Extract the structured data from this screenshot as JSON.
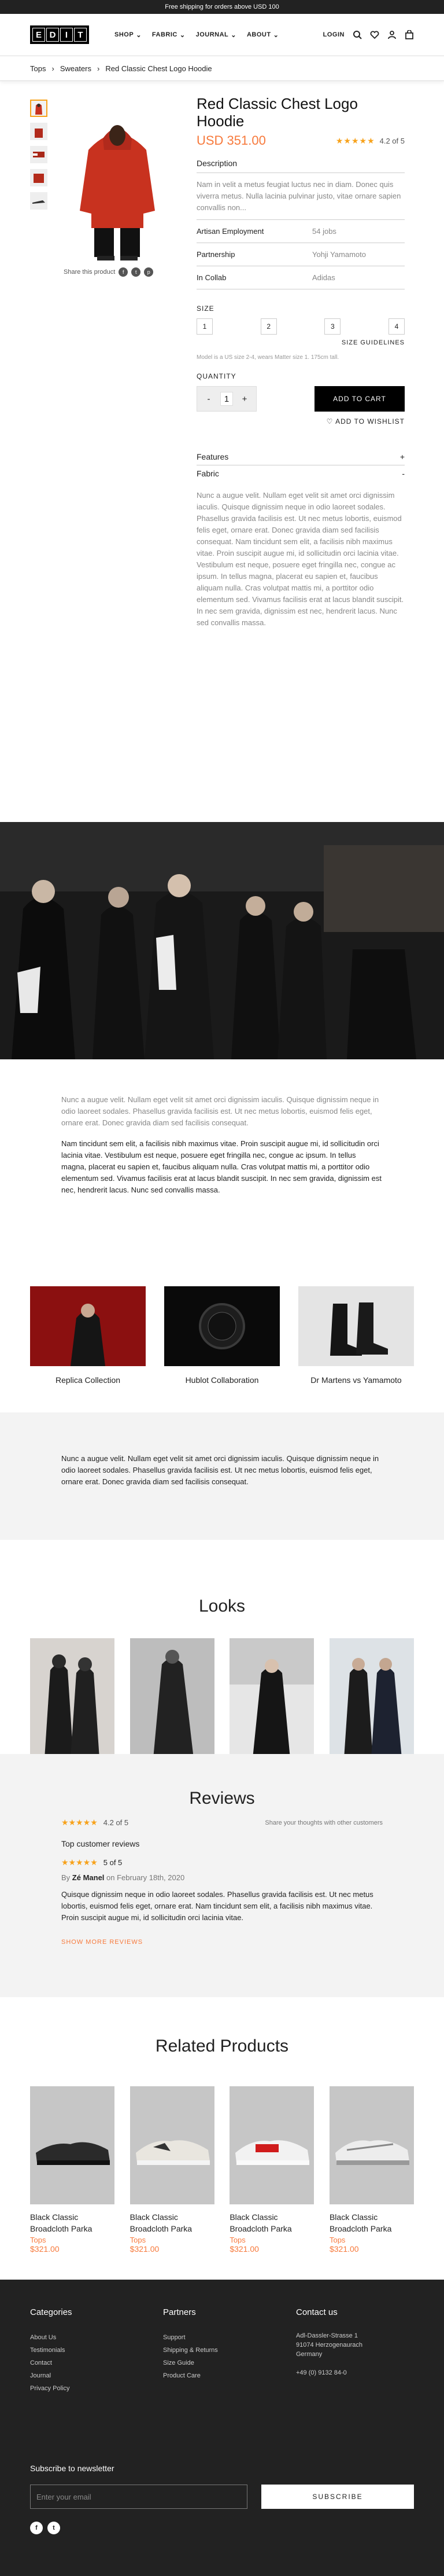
{
  "topbar": {
    "text": "Free shipping for orders above USD 100"
  },
  "header": {
    "logo": [
      "E",
      "D",
      "I",
      "T"
    ],
    "nav": [
      "SHOP",
      "FABRIC",
      "JOURNAL",
      "ABOUT"
    ],
    "login": "LOGIN",
    "icons": [
      "search-icon",
      "heart-icon",
      "user-icon",
      "bag-icon"
    ]
  },
  "breadcrumb": [
    "Tops",
    "Sweaters",
    "Red Classic Chest Logo Hoodie"
  ],
  "product": {
    "title": "Red Classic Chest Logo Hoodie",
    "price": "USD 351.00",
    "stars": "★★★★★",
    "rating": "4.2 of 5",
    "share": "Share this product",
    "desc_h": "Description",
    "description": "Nam in velit a metus feugiat luctus nec in diam. Donec quis viverra metus. Nulla lacinia pulvinar justo, vitae ornare sapien convallis non...",
    "specs": [
      {
        "k": "Artisan Employment",
        "v": "54 jobs"
      },
      {
        "k": "Partnership",
        "v": "Yohji Yamamoto"
      },
      {
        "k": "In Collab",
        "v": "Adidas"
      }
    ],
    "size_label": "SIZE",
    "sizes": [
      "1",
      "2",
      "3",
      "4"
    ],
    "size_guide": "SIZE GUIDELINES",
    "model_note": "Model is a US size 2-4, wears Matter size 1. 175cm tall.",
    "qty_label": "QUANTITY",
    "qty": "1",
    "minus": "-",
    "plus": "+",
    "add_to_cart": "ADD TO CART",
    "wishlist": "♡ ADD TO WISHLIST",
    "accordion": [
      {
        "label": "Features",
        "sign": "+"
      },
      {
        "label": "Fabric",
        "sign": "-"
      }
    ],
    "fabric_text": "Nunc a augue velit. Nullam eget velit sit amet orci dignissim iaculis. Quisque dignissim neque in odio laoreet sodales. Phasellus gravida facilisis est. Ut nec metus lobortis, euismod felis eget, ornare erat. Donec gravida diam sed facilisis consequat. Nam tincidunt sem elit, a facilisis nibh maximus vitae. Proin suscipit augue mi, id sollicitudin orci lacinia vitae. Vestibulum est neque, posuere eget fringilla nec, congue ac ipsum. In tellus magna, placerat eu sapien et, faucibus aliquam nulla. Cras volutpat mattis mi, a porttitor odio elementum sed. Vivamus facilisis erat at lacus blandit suscipit. In nec sem gravida, dignissim est nec, hendrerit lacus. Nunc sed convallis massa."
  },
  "story": {
    "grey": "Nunc a augue velit. Nullam eget velit sit amet orci dignissim iaculis. Quisque dignissim neque in odio laoreet sodales. Phasellus gravida facilisis est. Ut nec metus lobortis, euismod felis eget, ornare erat. Donec gravida diam sed facilisis consequat.",
    "dark": "Nam tincidunt sem elit, a facilisis nibh maximus vitae. Proin suscipit augue mi, id sollicitudin orci lacinia vitae. Vestibulum est neque, posuere eget fringilla nec, congue ac ipsum. In tellus magna, placerat eu sapien et, faucibus aliquam nulla. Cras volutpat mattis mi, a porttitor odio elementum sed. Vivamus facilisis erat at lacus blandit suscipit. In nec sem gravida, dignissim est nec, hendrerit lacus. Nunc sed convallis massa."
  },
  "collabs": [
    "Replica Collection",
    "Hublot Collaboration",
    "Dr Martens vs Yamamoto"
  ],
  "quote": "Nunc a augue velit. Nullam eget velit sit amet orci dignissim iaculis. Quisque dignissim neque in odio laoreet sodales. Phasellus gravida facilisis est. Ut nec metus lobortis, euismod felis eget, ornare erat. Donec gravida diam sed facilisis consequat.",
  "looks_title": "Looks",
  "reviews": {
    "title": "Reviews",
    "stars": "★★★★★",
    "rating": "4.2 of 5",
    "share": "Share your thoughts with other customers",
    "top": "Top customer reviews",
    "r_stars": "★★★★★",
    "r_rating": "5 of 5",
    "by": "By",
    "author": "Zé Manel",
    "on": "on February 18th, 2020",
    "text": "Quisque dignissim neque in odio laoreet sodales. Phasellus gravida facilisis est. Ut nec metus lobortis, euismod felis eget, ornare erat. Nam tincidunt sem elit, a facilisis nibh maximus vitae. Proin suscipit augue mi, id sollicitudin orci lacinia vitae.",
    "more": "SHOW MORE REVIEWS"
  },
  "related": {
    "title": "Related Products",
    "items": [
      {
        "name": "Black Classic Broadcloth Parka",
        "cat": "Tops",
        "price": "$321.00"
      },
      {
        "name": "Black Classic Broadcloth Parka",
        "cat": "Tops",
        "price": "$321.00"
      },
      {
        "name": "Black Classic Broadcloth Parka",
        "cat": "Tops",
        "price": "$321.00"
      },
      {
        "name": "Black Classic Broadcloth Parka",
        "cat": "Tops",
        "price": "$321.00"
      }
    ]
  },
  "footer": {
    "categories": {
      "title": "Categories",
      "items": [
        "About Us",
        "Testimonials",
        "Contact",
        "Journal",
        "Privacy Policy"
      ]
    },
    "partners": {
      "title": "Partners",
      "items": [
        "Support",
        "Shipping & Returns",
        "Size Guide",
        "Product Care"
      ]
    },
    "contact": {
      "title": "Contact us",
      "lines": [
        "Adl-Dassler-Strasse 1",
        "91074 Herzogenaurach",
        "Germany",
        "",
        "+49 (0) 9132 84-0"
      ]
    },
    "newsletter": "Subscribe to newsletter",
    "placeholder": "Enter your email",
    "subscribe": "SUBSCRIBE",
    "social": [
      "f",
      "t"
    ]
  },
  "colors": {
    "accent": "#f7793b",
    "star": "#f7a21b",
    "dark": "#222222"
  }
}
